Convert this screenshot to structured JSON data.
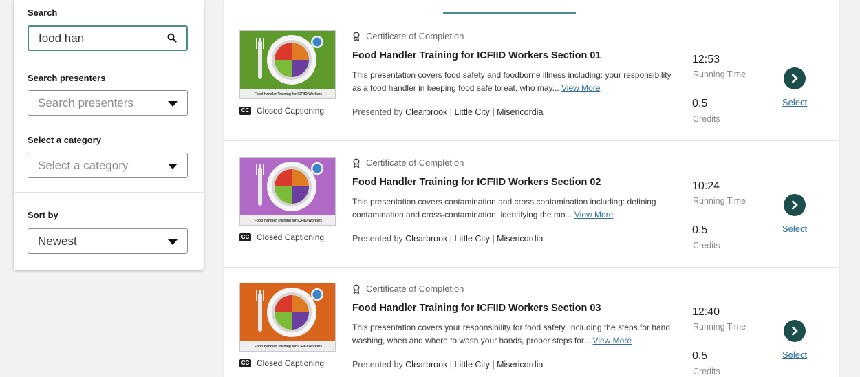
{
  "sidebar": {
    "search_label": "Search",
    "search_value": "food han",
    "presenters_label": "Search presenters",
    "presenters_placeholder": "Search presenters",
    "category_label": "Select a category",
    "category_placeholder": "Select a category",
    "sort_label": "Sort by",
    "sort_value": "Newest"
  },
  "accent_color": "#4a8d87",
  "button_color": "#1c4f4b",
  "results": [
    {
      "cert": "Certificate of Completion",
      "title": "Food Handler Training for ICFIID Workers Section 01",
      "desc": "This presentation covers food safety and foodborne illness including: your responsibility as a food handler in keeping food safe to eat, who may...",
      "view_more": "View More",
      "presented_by": "Presented by",
      "presenters": "Clearbrook | Little City | Misericordia",
      "cc": "Closed Captioning",
      "cc_badge": "CC",
      "time": "12:53",
      "time_label": "Running Time",
      "credits": "0.5",
      "credits_label": "Credits",
      "select": "Select",
      "thumb_caption": "Food Handler Training for ICFIID Workers",
      "thumb_color": "#5f9a2c"
    },
    {
      "cert": "Certificate of Completion",
      "title": "Food Handler Training for ICFIID Workers Section 02",
      "desc": "This presentation covers contamination and cross contamination including: defining contamination and cross-contamination, identifying the mo...",
      "view_more": "View More",
      "presented_by": "Presented by",
      "presenters": "Clearbrook | Little City | Misericordia",
      "cc": "Closed Captioning",
      "cc_badge": "CC",
      "time": "10:24",
      "time_label": "Running Time",
      "credits": "0.5",
      "credits_label": "Credits",
      "select": "Select",
      "thumb_caption": "Food Handler Training for ICFIID Workers",
      "thumb_color": "#b069c4"
    },
    {
      "cert": "Certificate of Completion",
      "title": "Food Handler Training for ICFIID Workers Section 03",
      "desc": "This presentation covers your responsibility for food safety, including the steps for hand washing, when and where to wash your hands, proper steps for...",
      "view_more": "View More",
      "presented_by": "Presented by",
      "presenters": "Clearbrook | Little City | Misericordia",
      "cc": "Closed Captioning",
      "cc_badge": "CC",
      "time": "12:40",
      "time_label": "Running Time",
      "credits": "0.5",
      "credits_label": "Credits",
      "select": "Select",
      "thumb_caption": "Food Handler Training for ICFIID Workers",
      "thumb_color": "#d9651c"
    }
  ]
}
